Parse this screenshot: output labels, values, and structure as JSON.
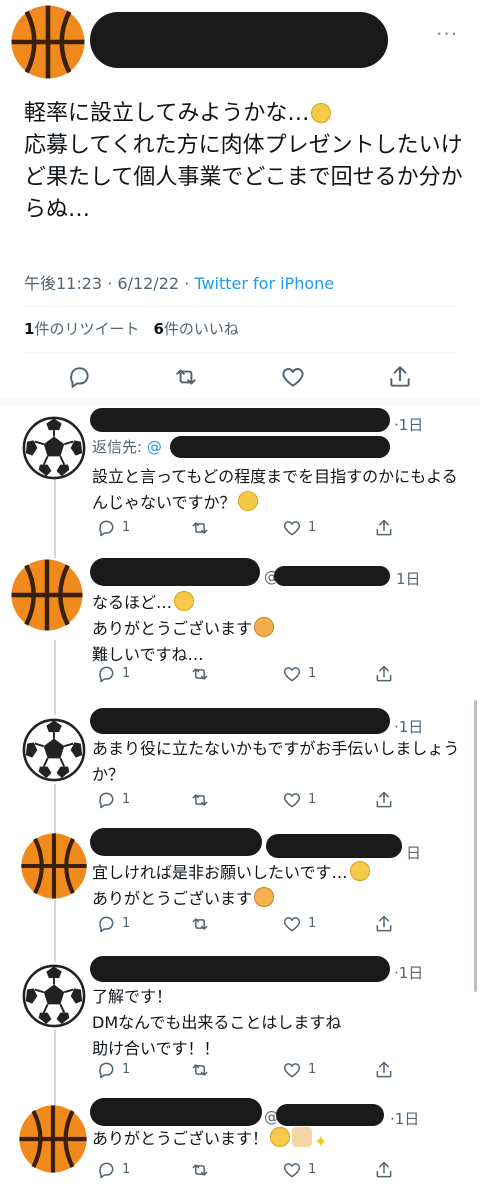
{
  "main_tweet": {
    "text": "軽率に設立してみようかな…",
    "text2": "応募してくれた方に肉体プレゼントしたいけど果たして個人事業でどこまで回せるか分からぬ…",
    "time": "午後11:23 · 6/12/22 · ",
    "source": "Twitter for iPhone",
    "retweets_count": "1",
    "retweets_label": "件のリツイート",
    "likes_count": "6",
    "likes_label": "件のいいね",
    "more": "···"
  },
  "replies": [
    {
      "time": "·1日",
      "reply_to_label": "返信先: ",
      "reply_to_at": "@",
      "text": "設立と言ってもどの程度までを目指すのかにもよるんじゃないですか？",
      "reply_count": "1",
      "like_count": "1",
      "avatar": "soccer-ball"
    },
    {
      "time": "1日",
      "at": "@",
      "text": "なるほど…",
      "text2": "ありがとうございます",
      "text3": "難しいですね…",
      "reply_count": "1",
      "like_count": "1",
      "avatar": "basketball"
    },
    {
      "time": "·1日",
      "text": "あまり役に立たないかもですがお手伝いしましょうか？",
      "reply_count": "1",
      "like_count": "1",
      "avatar": "soccer-ball"
    },
    {
      "time": "日",
      "text": "宜しければ是非お願いしたいです…",
      "text2": "ありがとうございます",
      "reply_count": "1",
      "like_count": "1",
      "avatar": "basketball"
    },
    {
      "time": "·1日",
      "text": "了解です！",
      "text2": "DMなんでも出来ることはしますね",
      "text3": "助け合いです！！",
      "reply_count": "1",
      "like_count": "1",
      "avatar": "soccer-ball"
    },
    {
      "time": "·1日",
      "at": "@",
      "text": "ありがとうございます！",
      "reply_count": "1",
      "like_count": "1",
      "avatar": "basketball"
    }
  ],
  "colors": {
    "link": "#1d9bf0",
    "secondary_text": "#536471",
    "basketball": "#f08a1c",
    "redaction": "#1a1a1a"
  }
}
